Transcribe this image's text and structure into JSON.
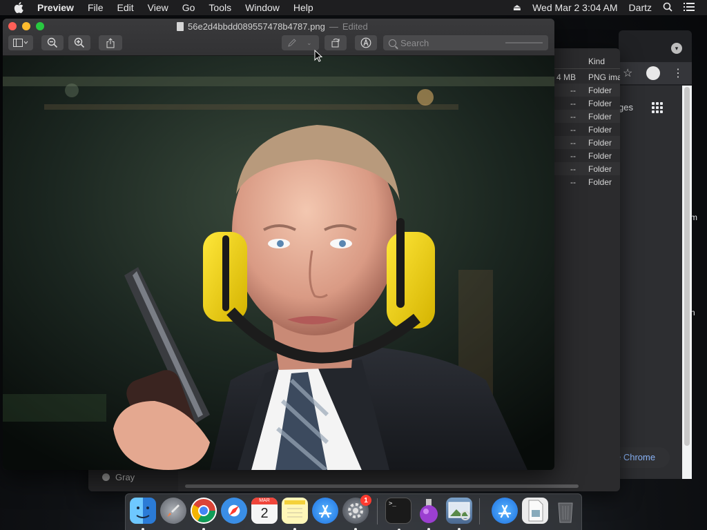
{
  "menubar": {
    "app": "Preview",
    "menus": [
      "File",
      "Edit",
      "View",
      "Go",
      "Tools",
      "Window",
      "Help"
    ],
    "datetime": "Wed Mar 2  3:04 AM",
    "user": "Dartz"
  },
  "preview_window": {
    "filename": "56e2d4bbdd089557478b4787.png",
    "separator": "—",
    "status": "Edited",
    "search_placeholder": "Search"
  },
  "finder": {
    "column_header": "Kind",
    "rows": [
      {
        "size": "4 MB",
        "kind": "PNG image"
      },
      {
        "size": "--",
        "kind": "Folder"
      },
      {
        "size": "--",
        "kind": "Folder"
      },
      {
        "size": "--",
        "kind": "Folder"
      },
      {
        "size": "--",
        "kind": "Folder"
      },
      {
        "size": "--",
        "kind": "Folder"
      },
      {
        "size": "--",
        "kind": "Folder"
      },
      {
        "size": "--",
        "kind": "Folder"
      },
      {
        "size": "--",
        "kind": "Folder"
      }
    ],
    "tag_label": "Gray"
  },
  "chrome": {
    "partial_text": "ges",
    "button_text": "e Chrome",
    "edge_m1": "m",
    "edge_m2": "n"
  },
  "dock": {
    "calendar_month": "MAR",
    "calendar_day": "2",
    "settings_badge": "1",
    "terminal_prompt": ">_"
  },
  "colors": {
    "menubar_bg": "#1e1e20",
    "close": "#ff5f57",
    "minimize": "#febc2e",
    "zoom": "#28c840",
    "earmuff_yellow": "#f2d200"
  }
}
